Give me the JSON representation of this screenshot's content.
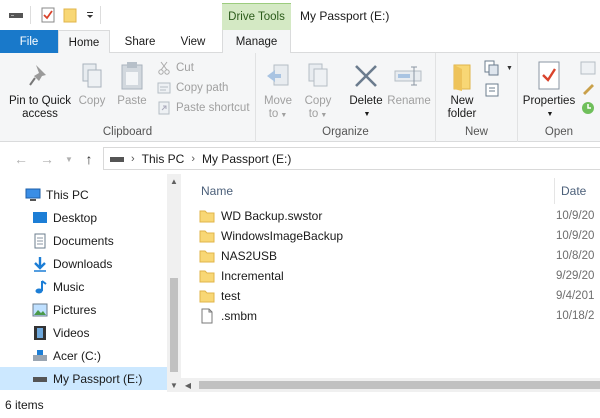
{
  "window": {
    "title": "My Passport (E:)",
    "context_tab": "Drive Tools"
  },
  "quick_access": [
    "drive-icon",
    "checkmark-properties-icon",
    "folder-icon",
    "dropdown-icon"
  ],
  "tabs": [
    "File",
    "Home",
    "Share",
    "View",
    "Manage"
  ],
  "ribbon": {
    "clipboard": {
      "label": "Clipboard",
      "pin_line1": "Pin to Quick",
      "pin_line2": "access",
      "copy": "Copy",
      "paste": "Paste",
      "cut": "Cut",
      "copy_path": "Copy path",
      "paste_shortcut": "Paste shortcut"
    },
    "organize": {
      "label": "Organize",
      "move_line1": "Move",
      "move_line2": "to",
      "copy_line1": "Copy",
      "copy_line2": "to",
      "delete": "Delete",
      "rename": "Rename"
    },
    "new": {
      "label": "New",
      "new_line1": "New",
      "new_line2": "folder"
    },
    "open": {
      "label": "Open",
      "properties": "Properties"
    }
  },
  "address": {
    "crumbs": [
      "This PC",
      "My Passport (E:)"
    ]
  },
  "nav_pane": {
    "items": [
      {
        "label": "This PC",
        "icon": "computer-icon"
      },
      {
        "label": "Desktop",
        "icon": "desktop-icon"
      },
      {
        "label": "Documents",
        "icon": "documents-icon"
      },
      {
        "label": "Downloads",
        "icon": "downloads-icon"
      },
      {
        "label": "Music",
        "icon": "music-icon"
      },
      {
        "label": "Pictures",
        "icon": "pictures-icon"
      },
      {
        "label": "Videos",
        "icon": "videos-icon"
      },
      {
        "label": "Acer (C:)",
        "icon": "system-drive-icon"
      },
      {
        "label": "My Passport (E:)",
        "icon": "drive-icon",
        "selected": true
      }
    ]
  },
  "file_list": {
    "columns": [
      "Name",
      "Date"
    ],
    "rows": [
      {
        "name": "WD Backup.swstor",
        "date": "10/9/20",
        "type": "folder"
      },
      {
        "name": "WindowsImageBackup",
        "date": "10/9/20",
        "type": "folder"
      },
      {
        "name": "NAS2USB",
        "date": "10/8/20",
        "type": "folder"
      },
      {
        "name": "Incremental",
        "date": "9/29/20",
        "type": "folder"
      },
      {
        "name": "test",
        "date": "9/4/201",
        "type": "folder"
      },
      {
        "name": ".smbm",
        "date": "10/18/2",
        "type": "file"
      }
    ]
  },
  "status": {
    "item_count": "6 items"
  },
  "colors": {
    "file_tab": "#1979ca",
    "drive_tools": "#d4e9c4",
    "folder": "#f8d775",
    "selection": "#cce8ff"
  }
}
